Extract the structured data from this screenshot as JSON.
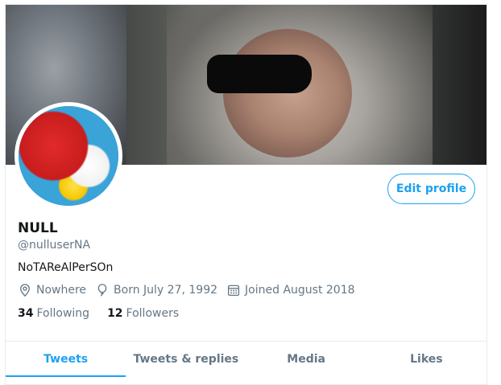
{
  "profile": {
    "name": "NULL",
    "handle": "@nulluserNA",
    "bio": "NoTAReAlPerSOn",
    "location": "Nowhere",
    "born": "Born July 27, 1992",
    "joined": "Joined August 2018"
  },
  "counts": {
    "following_value": "34",
    "following_label": "Following",
    "followers_value": "12",
    "followers_label": "Followers"
  },
  "actions": {
    "edit_profile": "Edit profile"
  },
  "tabs": [
    {
      "label": "Tweets",
      "active": true
    },
    {
      "label": "Tweets & replies",
      "active": false
    },
    {
      "label": "Media",
      "active": false
    },
    {
      "label": "Likes",
      "active": false
    }
  ],
  "icons": {
    "location": "location-pin-icon",
    "birthday": "balloon-icon",
    "joined": "calendar-icon"
  },
  "colors": {
    "accent": "#1da1f2",
    "secondary_text": "#657786",
    "primary_text": "#14171a"
  }
}
